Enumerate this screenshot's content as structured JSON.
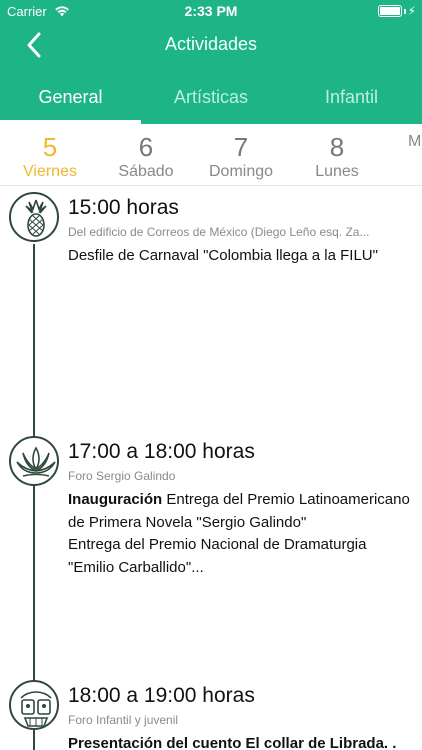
{
  "status_bar": {
    "carrier": "Carrier",
    "time": "2:33 PM"
  },
  "nav": {
    "title": "Actividades"
  },
  "tabs": [
    {
      "label": "General",
      "selected": true
    },
    {
      "label": "Artísticas",
      "selected": false
    },
    {
      "label": "Infantil",
      "selected": false
    }
  ],
  "days": [
    {
      "num": "5",
      "name": "Viernes",
      "selected": true
    },
    {
      "num": "6",
      "name": "Sábado",
      "selected": false
    },
    {
      "num": "7",
      "name": "Domingo",
      "selected": false
    },
    {
      "num": "8",
      "name": "Lunes",
      "selected": false
    },
    {
      "num": "",
      "name": "M",
      "selected": false
    }
  ],
  "events": [
    {
      "icon": "pineapple-icon",
      "time": "15:00 horas",
      "venue": "Del edificio de Correos de México (Diego Leño esq. Za...",
      "desc_bold": "",
      "desc": "Desfile de Carnaval \"Colombia llega a la FILU\""
    },
    {
      "icon": "lotus-icon",
      "time": "17:00 a 18:00 horas",
      "venue": "Foro Sergio Galindo",
      "desc_bold": "Inauguración",
      "desc": "Entrega del Premio Latinoamericano de Primera Novela \"Sergio Galindo\"",
      "desc2": "Entrega del Premio Nacional de Dramaturgia \"Emilio Carballido\"..."
    },
    {
      "icon": "mask-icon",
      "time": "18:00 a 19:00 horas",
      "venue": "Foro Infantil y juvenil",
      "desc_bold": "Presentación del cuento El collar de Librada. .",
      "desc": ""
    }
  ],
  "colors": {
    "primary": "#1db486",
    "accent": "#f2b72c",
    "timeline": "#2f4a3c"
  }
}
